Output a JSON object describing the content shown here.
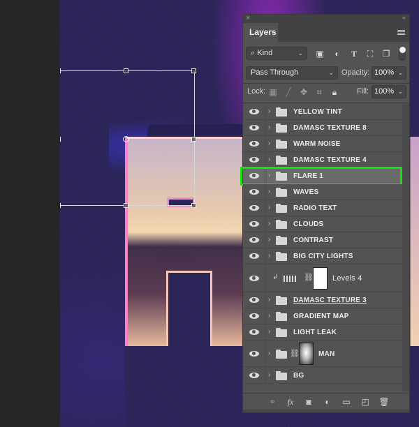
{
  "panel": {
    "close_glyph": "×",
    "collapse_glyph": "‹‹",
    "tab_label": "Layers",
    "menu_icon": "panel-menu-icon"
  },
  "filter": {
    "kind_label": "Kind",
    "search_glyph": "⌕",
    "icons": [
      "image-filter-icon",
      "adjustment-filter-icon",
      "type-filter-icon",
      "shape-filter-icon",
      "smart-object-filter-icon"
    ]
  },
  "blend": {
    "mode": "Pass Through",
    "opacity_label": "Opacity:",
    "opacity_value": "100%"
  },
  "lock": {
    "label": "Lock:",
    "icons": [
      "lock-transparent-icon",
      "lock-image-icon",
      "lock-position-icon",
      "lock-artboard-icon",
      "lock-all-icon"
    ],
    "fill_label": "Fill:",
    "fill_value": "100%"
  },
  "layers": [
    {
      "name": "YELLOW TINT",
      "type": "group",
      "visible": true
    },
    {
      "name": "DAMASC TEXTURE 8",
      "type": "group",
      "visible": true
    },
    {
      "name": "WARM NOISE",
      "type": "group",
      "visible": true
    },
    {
      "name": "DAMASC TEXTURE 4",
      "type": "group",
      "visible": true
    },
    {
      "name": "FLARE 1",
      "type": "group",
      "visible": true,
      "selected": true
    },
    {
      "name": "WAVES",
      "type": "group",
      "visible": true
    },
    {
      "name": "RADIO TEXT",
      "type": "group",
      "visible": true
    },
    {
      "name": "CLOUDS",
      "type": "group",
      "visible": true
    },
    {
      "name": "CONTRAST",
      "type": "group",
      "visible": true
    },
    {
      "name": "BIG CITY LIGHTS",
      "type": "group",
      "visible": true
    },
    {
      "name": "Levels 4",
      "type": "adjustment-levels",
      "visible": true,
      "clipped": true
    },
    {
      "name": "DAMASC TEXTURE 3",
      "type": "group",
      "visible": true
    },
    {
      "name": "GRADIENT MAP",
      "type": "group",
      "visible": true
    },
    {
      "name": "LIGHT LEAK",
      "type": "group",
      "visible": true
    },
    {
      "name": "MAN",
      "type": "group-masked",
      "visible": true
    },
    {
      "name": "BG",
      "type": "group",
      "visible": true
    }
  ],
  "footer": {
    "icons": [
      "link-layers-icon",
      "fx-icon",
      "add-mask-icon",
      "new-adjustment-icon",
      "new-group-icon",
      "new-layer-icon",
      "delete-layer-icon"
    ],
    "fx_label": "fx"
  },
  "highlight_color": "#14e40e"
}
